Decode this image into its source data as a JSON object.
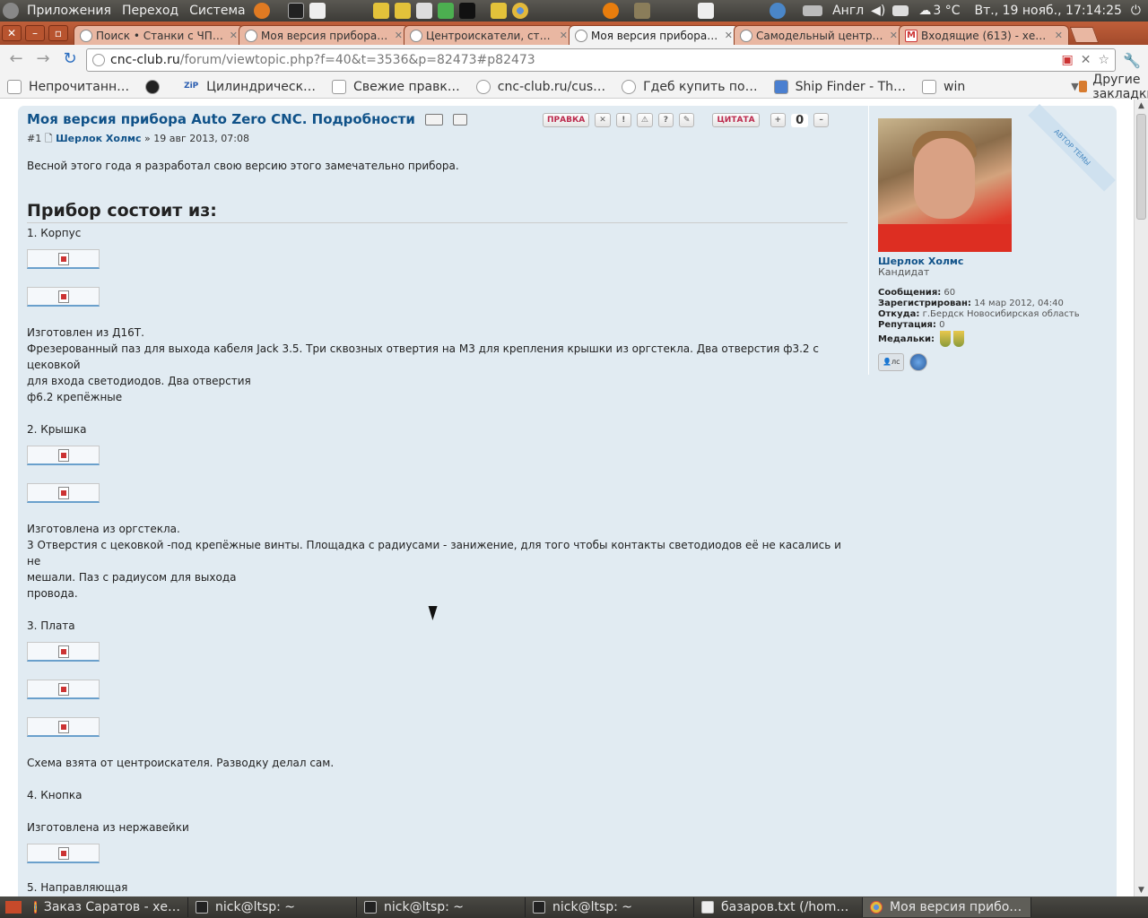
{
  "top_panel": {
    "menus": [
      "Приложения",
      "Переход",
      "Система"
    ],
    "language": "Англ",
    "weather": "3 °C",
    "datetime": "Вт., 19 нояб., 17:14:25"
  },
  "tabs": [
    {
      "label": "Поиск • Станки с ЧПУ на с",
      "active": false
    },
    {
      "label": "Моя версия прибора Auto",
      "active": false
    },
    {
      "label": "Центроискатели, стилус",
      "active": false
    },
    {
      "label": "Моя версия прибора Auto",
      "active": true
    },
    {
      "label": "Самодельный центроиск",
      "active": false
    },
    {
      "label": "Входящие (613) - хересі",
      "active": false
    }
  ],
  "toolbar": {
    "url_host": "cnc-club.ru",
    "url_rest": "/forum/viewtopic.php?f=40&t=3536&p=82473#p82473"
  },
  "bookmarks": {
    "items": [
      "Непрочитанн…",
      "Цилиндрическ…",
      "Свежие правк…",
      "cnc-club.ru/cus…",
      "Гдеб купить по…",
      "Ship Finder - Th…",
      "win"
    ],
    "zip_badge": "ZiP",
    "other": "Другие закладки"
  },
  "post": {
    "title": "Моя версия прибора Auto Zero CNC. Подробности",
    "number": "#1",
    "author": "Шерлок Холмс",
    "date": "» 19 авг 2013, 07:08",
    "actions": {
      "edit": "ПРАВКА",
      "quote": "ЦИТАТА",
      "votes": "0"
    },
    "intro": "Весной этого года я разработал свою версию этого замечательно прибора.",
    "heading": "Прибор состоит из:",
    "sections": [
      {
        "title": "1. Корпус",
        "images": 2,
        "text": [
          "Изготовлен из Д16Т.",
          "Фрезерованный паз для выхода кабеля Jack 3.5. Три сквозных отвертия на М3 для крепления крышки из оргстекла. Два отверстия ф3.2 с цековкой",
          "для входа светодиодов. Два отверстия",
          "ф6.2 крепёжные"
        ]
      },
      {
        "title": "2. Крышка",
        "images": 2,
        "text": [
          "Изготовлена из оргстекла.",
          "3 Отверстия с цековкой -под крепёжные винты. Площадка с радиусами - занижение, для того чтобы контакты светодиодов её не касались и не",
          "мешали. Паз с радиусом для выхода",
          "провода."
        ]
      },
      {
        "title": "3. Плата",
        "images": 3,
        "text": [
          "Схема взята от центроискателя. Разводку делал сам."
        ]
      },
      {
        "title": "4. Кнопка",
        "images": 1,
        "text_before": [
          "Изготовлена из нержавейки"
        ]
      },
      {
        "title": "5. Направляющая"
      }
    ]
  },
  "profile": {
    "ribbon": "АВТОР ТЕМЫ",
    "name": "Шерлок Холмс",
    "rank": "Кандидат",
    "messages_label": "Сообщения:",
    "messages": "60",
    "registered_label": "Зарегистрирован:",
    "registered": "14 мар 2012, 04:40",
    "from_label": "Откуда:",
    "from": "г.Бердск Новосибирская область",
    "reputation_label": "Репутация:",
    "reputation": "0",
    "medals_label": "Медальки:",
    "pm_label": "лс"
  },
  "taskbar": [
    {
      "label": "Заказ Саратов - хе…",
      "icon": "chrome",
      "active": false
    },
    {
      "label": "nick@ltsp: ~",
      "icon": "terminal",
      "active": false
    },
    {
      "label": "nick@ltsp: ~",
      "icon": "terminal",
      "active": false
    },
    {
      "label": "nick@ltsp: ~",
      "icon": "terminal",
      "active": false
    },
    {
      "label": "базаров.txt (/hom…",
      "icon": "text-editor",
      "active": false
    },
    {
      "label": "Моя версия прибо…",
      "icon": "chrome",
      "active": true
    }
  ],
  "colors": {
    "link": "#105289",
    "post_bg": "#e1ebf2",
    "tab_strip": "#a24a2b"
  }
}
